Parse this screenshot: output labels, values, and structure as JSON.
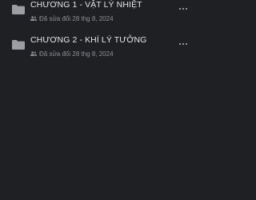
{
  "items": [
    {
      "title": "CHƯƠNG 1 - VẬT LÝ NHIỆT",
      "meta": "Đã sửa đổi 28 thg 8, 2024",
      "icon": "folder-icon",
      "shared_icon": "people-icon",
      "more_icon": "more-icon"
    },
    {
      "title": "CHƯƠNG 2 - KHÍ LÝ TƯỞNG",
      "meta": "Đã sửa đổi 28 thg 8, 2024",
      "icon": "folder-icon",
      "shared_icon": "people-icon",
      "more_icon": "more-icon"
    }
  ],
  "colors": {
    "background": "#1f2023",
    "title": "#e6e6e8",
    "meta": "#8f9096",
    "icon": "#9d9ea4"
  }
}
